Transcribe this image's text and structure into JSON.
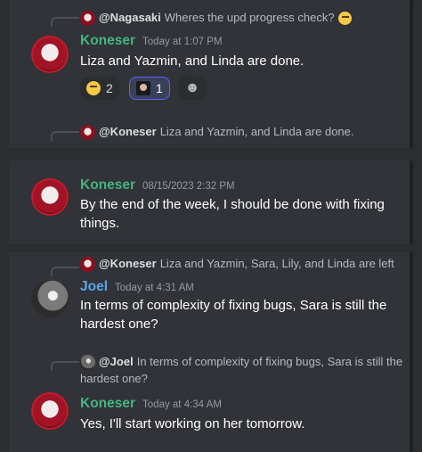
{
  "blocks": {
    "first": {
      "reply": {
        "mention": "@Nagasaki",
        "text": "Wheres the upd progress check?"
      },
      "author": "Koneser",
      "time": "Today at 1:07 PM",
      "content": "Liza and Yazmin, and Linda are done.",
      "reactions": [
        {
          "emoji": "face-with-party-horn",
          "count": "2"
        },
        {
          "emoji": "custom-portrait",
          "count": "1"
        }
      ],
      "add_reaction_icon": "add-reaction-icon",
      "next_reply": {
        "mention": "@Koneser",
        "text": "Liza and Yazmin, and Linda are done."
      }
    },
    "second": {
      "author": "Koneser",
      "time": "08/15/2023 2:32 PM",
      "content": "By the end of the week, I should be done with fixing things."
    },
    "third": {
      "reply": {
        "mention": "@Koneser",
        "text": "Liza and Yazmin, Sara, Lily, and Linda are left"
      },
      "author": "Joel",
      "time": "Today at 4:31 AM",
      "content": "In terms of complexity of fixing bugs, Sara is still the hardest one?",
      "reply2": {
        "mention": "@Joel",
        "text": "In terms of complexity of fixing bugs, Sara is still the hardest one?"
      },
      "author2": "Koneser",
      "time2": "Today at 4:34 AM",
      "content2": "Yes, I'll start working on her tomorrow."
    }
  },
  "colors": {
    "koneser": "#43b581",
    "joel": "#5aa6e8",
    "background": "#313338"
  }
}
